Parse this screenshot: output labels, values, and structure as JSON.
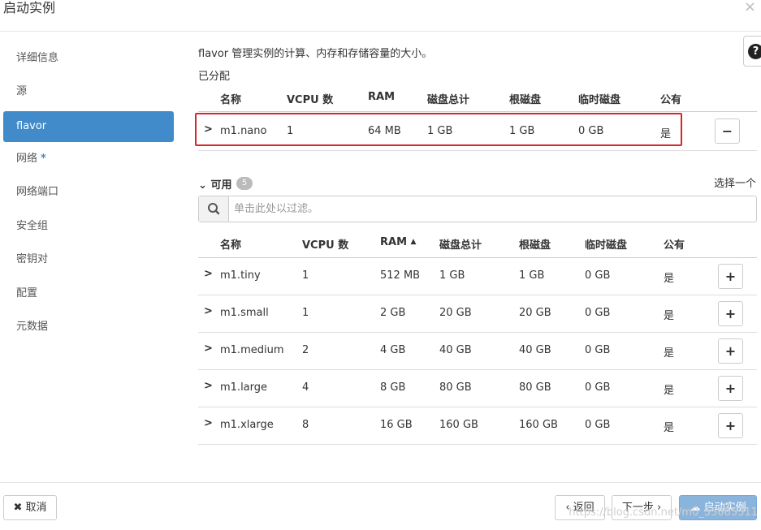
{
  "window": {
    "title": "启动实例",
    "close": "×"
  },
  "sidebar": {
    "items": [
      {
        "label": "详细信息",
        "active": false
      },
      {
        "label": "源",
        "active": false
      },
      {
        "label": "flavor",
        "active": true
      },
      {
        "label": "网络",
        "active": false,
        "required_mark": "*"
      },
      {
        "label": "网络端口",
        "active": false
      },
      {
        "label": "安全组",
        "active": false
      },
      {
        "label": "密钥对",
        "active": false
      },
      {
        "label": "配置",
        "active": false
      },
      {
        "label": "元数据",
        "active": false
      }
    ]
  },
  "main": {
    "description": "flavor 管理实例的计算、内存和存储容量的大小。",
    "help": "?",
    "allocated": {
      "title": "已分配",
      "columns": [
        "名称",
        "VCPU 数",
        "RAM",
        "磁盘总计",
        "根磁盘",
        "临时磁盘",
        "公有"
      ],
      "rows": [
        {
          "name": "m1.nano",
          "vcpu": "1",
          "ram": "64 MB",
          "disk": "1 GB",
          "root": "1 GB",
          "ephemeral": "0 GB",
          "public": "是",
          "action": "−"
        }
      ]
    },
    "available": {
      "title": "可用",
      "count": "5",
      "select_hint": "选择一个",
      "search_placeholder": "单击此处以过滤。",
      "columns": [
        "名称",
        "VCPU 数",
        "RAM",
        "磁盘总计",
        "根磁盘",
        "临时磁盘",
        "公有"
      ],
      "sort_indicator": "▲",
      "rows": [
        {
          "name": "m1.tiny",
          "vcpu": "1",
          "ram": "512 MB",
          "disk": "1 GB",
          "root": "1 GB",
          "ephemeral": "0 GB",
          "public": "是",
          "action": "+"
        },
        {
          "name": "m1.small",
          "vcpu": "1",
          "ram": "2 GB",
          "disk": "20 GB",
          "root": "20 GB",
          "ephemeral": "0 GB",
          "public": "是",
          "action": "+"
        },
        {
          "name": "m1.medium",
          "vcpu": "2",
          "ram": "4 GB",
          "disk": "40 GB",
          "root": "40 GB",
          "ephemeral": "0 GB",
          "public": "是",
          "action": "+"
        },
        {
          "name": "m1.large",
          "vcpu": "4",
          "ram": "8 GB",
          "disk": "80 GB",
          "root": "80 GB",
          "ephemeral": "0 GB",
          "public": "是",
          "action": "+"
        },
        {
          "name": "m1.xlarge",
          "vcpu": "8",
          "ram": "16 GB",
          "disk": "160 GB",
          "root": "160 GB",
          "ephemeral": "0 GB",
          "public": "是",
          "action": "+"
        }
      ]
    }
  },
  "footer": {
    "cancel": "✖ 取消",
    "back": "‹ 返回",
    "next": "下一步 ›",
    "launch": "启动实例",
    "watermark": "https://blog.csdn.net/m0_55005311"
  },
  "colors": {
    "accent": "#428bca",
    "highlight_border": "#d9252a",
    "launch_disabled": "#8ab4dc"
  }
}
